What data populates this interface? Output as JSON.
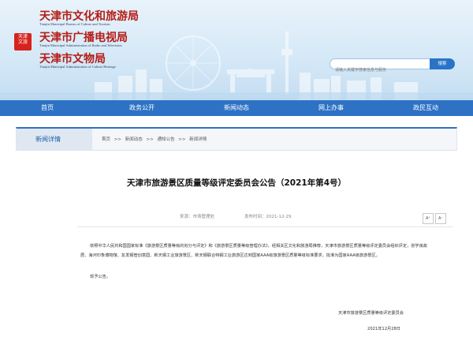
{
  "header": {
    "seal_text": "天津文旅",
    "orgs": [
      {
        "cn": "天津市文化和旅游局",
        "en": "Tianjin Municipal Bureau of Culture and Tourism"
      },
      {
        "cn": "天津市广播电视局",
        "en": "Tianjin Municipal Administration of Radio and Television"
      },
      {
        "cn": "天津市文物局",
        "en": "Tianjin Municipal Administration of Culture Heritage"
      }
    ],
    "search_placeholder": "请输入关键字搜索信息与服务",
    "search_button": "搜索"
  },
  "nav": [
    "首页",
    "政务公开",
    "新闻动态",
    "网上办事",
    "政民互动"
  ],
  "breadcrumb": {
    "section_title": "新闻详情",
    "items": [
      "首页",
      ">>",
      "新闻动态",
      ">>",
      "通知公告",
      ">>",
      "新闻详情"
    ]
  },
  "article": {
    "title": "天津市旅游景区质量等级评定委员会公告（2021年第4号）",
    "source_label": "来源：市场管理处",
    "date_label": "发布时间：2021-12-29",
    "font_large": "A⁺",
    "font_small": "A⁻",
    "paragraph": "依照中华人民共和国国家标准《旅游景区质量等级的划分与评定》和《旅游景区质量等级管理办法》，经相关区文化和旅游局推荐，天津市旅游景区质量等级评定委员会组织评定，张学良故居、海河印象博物馆、友发钢管创意园、新天钢工业旅游景区、新天钢联合特钢工业旅游区达到国家AAA级旅游景区质量等级标准要求，批准为国家AAA级旅游景区。",
    "notice": "现予公告。",
    "signature": "天津市旅游景区质量等级评定委员会",
    "sign_date": "2021年12月28日"
  },
  "colors": {
    "brand_blue": "#2d72c5",
    "brand_red": "#b51c16"
  }
}
